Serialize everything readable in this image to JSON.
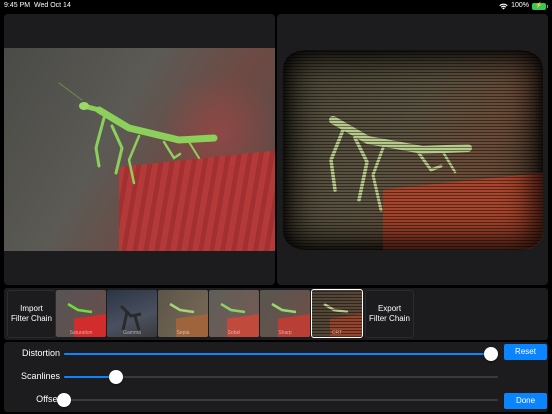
{
  "status_bar": {
    "time": "9:45 PM",
    "date": "Wed Oct 14",
    "battery_percent": "100%",
    "icons": [
      "wifi-icon",
      "battery-icon"
    ]
  },
  "filter_strip": {
    "import_label_line1": "Import",
    "import_label_line2": "Filter Chain",
    "export_label_line1": "Export",
    "export_label_line2": "Filter Chain",
    "filters": [
      {
        "label": "Saturation"
      },
      {
        "label": "Gamma"
      },
      {
        "label": "Sepia"
      },
      {
        "label": "Sobel"
      },
      {
        "label": "Sharp"
      },
      {
        "label": "CRT",
        "selected": true
      }
    ]
  },
  "controls": {
    "sliders": [
      {
        "label": "Distortion",
        "value": 1.0
      },
      {
        "label": "Scanlines",
        "value": 0.12
      },
      {
        "label": "Offset",
        "value": 0.0
      }
    ],
    "reset_label": "Reset",
    "done_label": "Done"
  },
  "colors": {
    "accent": "#0a84ff",
    "panel": "#1c1c1e",
    "background": "#000000"
  }
}
